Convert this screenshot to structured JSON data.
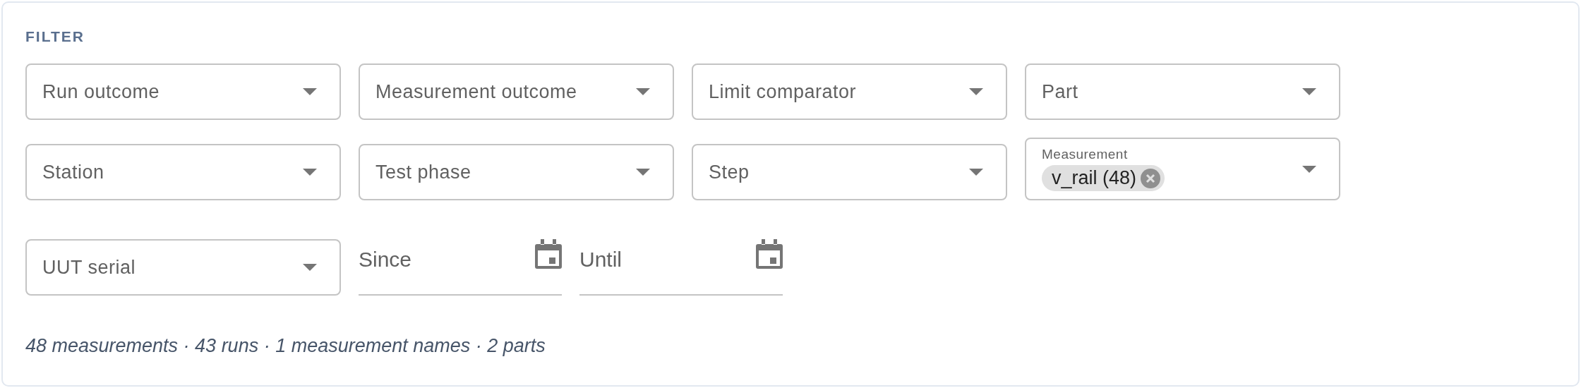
{
  "title": "FILTER",
  "rows": [
    [
      {
        "kind": "select",
        "label": "Run outcome"
      },
      {
        "kind": "select",
        "label": "Measurement outcome"
      },
      {
        "kind": "select",
        "label": "Limit comparator"
      },
      {
        "kind": "select",
        "label": "Part"
      }
    ],
    [
      {
        "kind": "select",
        "label": "Station"
      },
      {
        "kind": "select",
        "label": "Test phase"
      },
      {
        "kind": "select",
        "label": "Step"
      },
      {
        "kind": "chips",
        "label": "Measurement",
        "chips": [
          "v_rail (48)"
        ]
      }
    ],
    [
      {
        "kind": "select",
        "label": "UUT serial"
      },
      {
        "kind": "date",
        "label": "Since"
      },
      {
        "kind": "date",
        "label": "Until"
      }
    ]
  ],
  "summary": "48 measurements · 43 runs · 1 measurement names · 2 parts"
}
